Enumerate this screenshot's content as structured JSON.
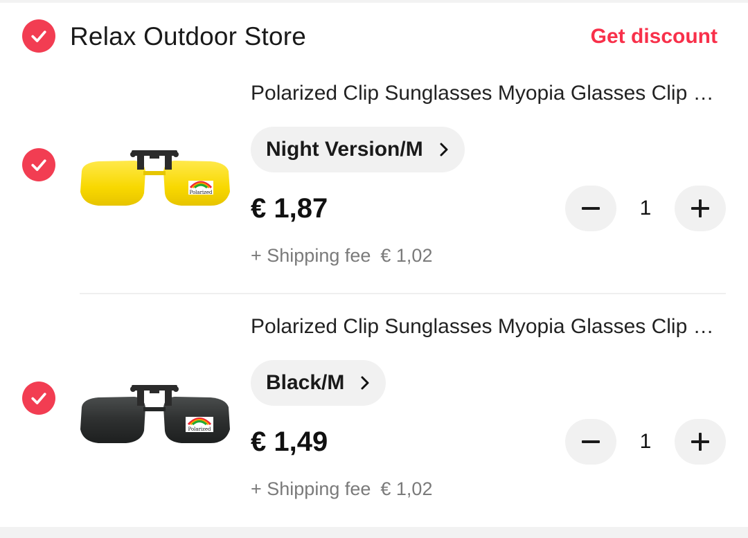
{
  "theme": {
    "accent": "#f23d52",
    "discount_color": "#f8304a",
    "chip_bg": "#f1f1f1"
  },
  "store": {
    "name": "Relax Outdoor Store",
    "discount_label": "Get discount",
    "checked": true
  },
  "items": [
    {
      "title": "Polarized Clip Sunglasses Myopia Glasses Clip On Driving Night Vision Lens",
      "variant": "Night Version/M",
      "price": "€ 1,87",
      "shipping_label": "+ Shipping fee",
      "shipping_fee": "€ 1,02",
      "quantity": "1",
      "checked": true,
      "lens_color": "yellow",
      "lens_badge": "Polarized",
      "icons": {
        "check": "check-icon",
        "variant": "chevron-right-icon",
        "minus": "minus-icon",
        "plus": "plus-icon"
      }
    },
    {
      "title": "Polarized Clip Sunglasses Myopia Glasses Clip On Driving Night Vision Lens",
      "variant": "Black/M",
      "price": "€ 1,49",
      "shipping_label": "+ Shipping fee",
      "shipping_fee": "€ 1,02",
      "quantity": "1",
      "checked": true,
      "lens_color": "black",
      "lens_badge": "Polarized",
      "icons": {
        "check": "check-icon",
        "variant": "chevron-right-icon",
        "minus": "minus-icon",
        "plus": "plus-icon"
      }
    }
  ]
}
